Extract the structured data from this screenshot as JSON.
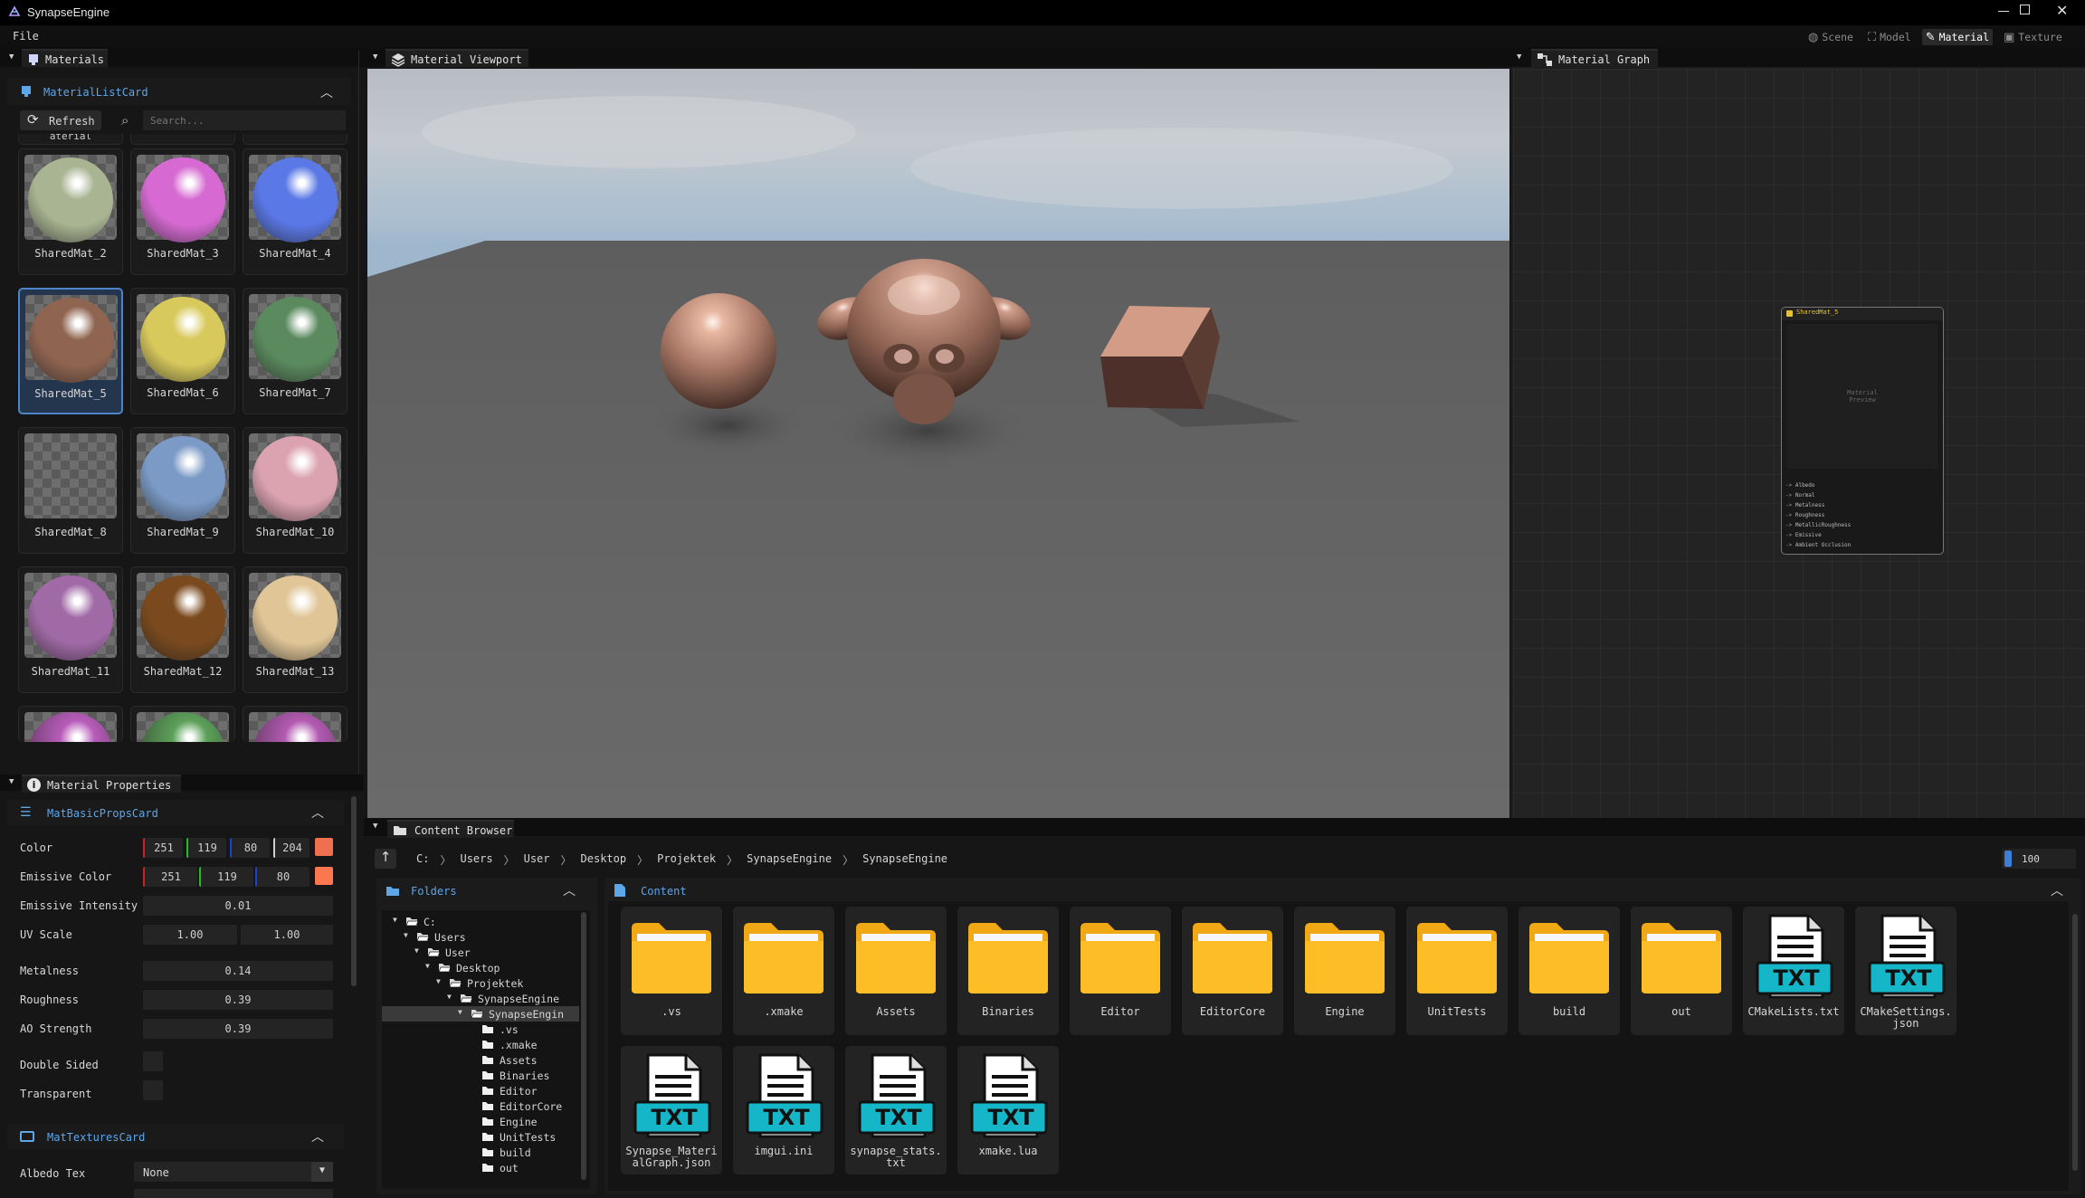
{
  "window": {
    "title": "SynapseEngine"
  },
  "menu": {
    "file": "File"
  },
  "modes": [
    {
      "label": "Scene",
      "icon": "globe-icon"
    },
    {
      "label": "Model",
      "icon": "model-icon"
    },
    {
      "label": "Material",
      "icon": "brush-icon"
    },
    {
      "label": "Texture",
      "icon": "image-icon"
    }
  ],
  "materials_panel": {
    "title": "Materials",
    "card_title": "MaterialListCard",
    "refresh_label": "Refresh",
    "search_placeholder": "Search...",
    "clipped_label": "aterial",
    "items": [
      {
        "name": "SharedMat_2",
        "color": "#a9b492"
      },
      {
        "name": "SharedMat_3",
        "color": "#d66ad2"
      },
      {
        "name": "SharedMat_4",
        "color": "#5a78e6"
      },
      {
        "name": "SharedMat_5",
        "color": "#8f6450",
        "selected": true
      },
      {
        "name": "SharedMat_6",
        "color": "#d8c95c"
      },
      {
        "name": "SharedMat_7",
        "color": "#5b8a5e"
      },
      {
        "name": "SharedMat_8",
        "color": "transparent"
      },
      {
        "name": "SharedMat_9",
        "color": "#7b9ac6"
      },
      {
        "name": "SharedMat_10",
        "color": "#dba2b0"
      },
      {
        "name": "SharedMat_11",
        "color": "#a06aa6"
      },
      {
        "name": "SharedMat_12",
        "color": "#7a4a1e"
      },
      {
        "name": "SharedMat_13",
        "color": "#e0c596"
      }
    ],
    "partial_colors": [
      "#b85cba",
      "#5da15a",
      "#b35ab2"
    ]
  },
  "properties_panel": {
    "title": "Material Properties",
    "basic_card": "MatBasicPropsCard",
    "color": {
      "label": "Color",
      "r": "251",
      "g": "119",
      "b": "80",
      "a": "204",
      "swatch": "#f06f50"
    },
    "emissive_color": {
      "label": "Emissive Color",
      "r": "251",
      "g": "119",
      "b": "80",
      "swatch": "#fb7750"
    },
    "emissive_intensity": {
      "label": "Emissive Intensity",
      "value": "0.01"
    },
    "uv_scale": {
      "label": "UV Scale",
      "u": "1.00",
      "v": "1.00"
    },
    "metalness": {
      "label": "Metalness",
      "value": "0.14"
    },
    "roughness": {
      "label": "Roughness",
      "value": "0.39"
    },
    "ao_strength": {
      "label": "AO Strength",
      "value": "0.39"
    },
    "double_sided": {
      "label": "Double Sided"
    },
    "transparent": {
      "label": "Transparent"
    },
    "textures_card": "MatTexturesCard",
    "albedo_tex": {
      "label": "Albedo Tex",
      "value": "None"
    }
  },
  "viewport": {
    "title": "Material Viewport"
  },
  "graph": {
    "title": "Material Graph",
    "node_title": "SharedMat_5",
    "preview_text": "Material\nPreview",
    "ports": [
      "Albedo",
      "Normal",
      "Metalness",
      "Roughness",
      "MetallicRoughness",
      "Emissive",
      "Ambient Occlusion"
    ]
  },
  "content_browser": {
    "title": "Content Browser",
    "breadcrumb": [
      "C:",
      "Users",
      "User",
      "Desktop",
      "Projektek",
      "SynapseEngine",
      "SynapseEngine"
    ],
    "zoom": "100",
    "zoom_fraction": 0.02,
    "folders_title": "Folders",
    "content_title": "Content",
    "tree": [
      {
        "label": "C:",
        "depth": 0,
        "open": true
      },
      {
        "label": "Users",
        "depth": 1,
        "open": true
      },
      {
        "label": "User",
        "depth": 2,
        "open": true
      },
      {
        "label": "Desktop",
        "depth": 3,
        "open": true
      },
      {
        "label": "Projektek",
        "depth": 4,
        "open": true
      },
      {
        "label": "SynapseEngine",
        "depth": 5,
        "open": true
      },
      {
        "label": "SynapseEngin",
        "depth": 6,
        "open": true,
        "selected": true
      },
      {
        "label": ".vs",
        "depth": 7
      },
      {
        "label": ".xmake",
        "depth": 7
      },
      {
        "label": "Assets",
        "depth": 7
      },
      {
        "label": "Binaries",
        "depth": 7
      },
      {
        "label": "Editor",
        "depth": 7
      },
      {
        "label": "EditorCore",
        "depth": 7
      },
      {
        "label": "Engine",
        "depth": 7
      },
      {
        "label": "UnitTests",
        "depth": 7
      },
      {
        "label": "build",
        "depth": 7
      },
      {
        "label": "out",
        "depth": 7
      }
    ],
    "items": [
      {
        "name": ".vs",
        "kind": "folder"
      },
      {
        "name": ".xmake",
        "kind": "folder"
      },
      {
        "name": "Assets",
        "kind": "folder"
      },
      {
        "name": "Binaries",
        "kind": "folder"
      },
      {
        "name": "Editor",
        "kind": "folder"
      },
      {
        "name": "EditorCore",
        "kind": "folder"
      },
      {
        "name": "Engine",
        "kind": "folder"
      },
      {
        "name": "UnitTests",
        "kind": "folder"
      },
      {
        "name": "build",
        "kind": "folder"
      },
      {
        "name": "out",
        "kind": "folder"
      },
      {
        "name": "CMakeLists.txt",
        "kind": "txt"
      },
      {
        "name": "CMakeSettings.\njson",
        "kind": "txt"
      },
      {
        "name": "Synapse_Materi\nalGraph.json",
        "kind": "txt"
      },
      {
        "name": "imgui.ini",
        "kind": "txt"
      },
      {
        "name": "synapse_stats.\ntxt",
        "kind": "txt"
      },
      {
        "name": "xmake.lua",
        "kind": "txt"
      }
    ],
    "file_badge": "TXT"
  }
}
